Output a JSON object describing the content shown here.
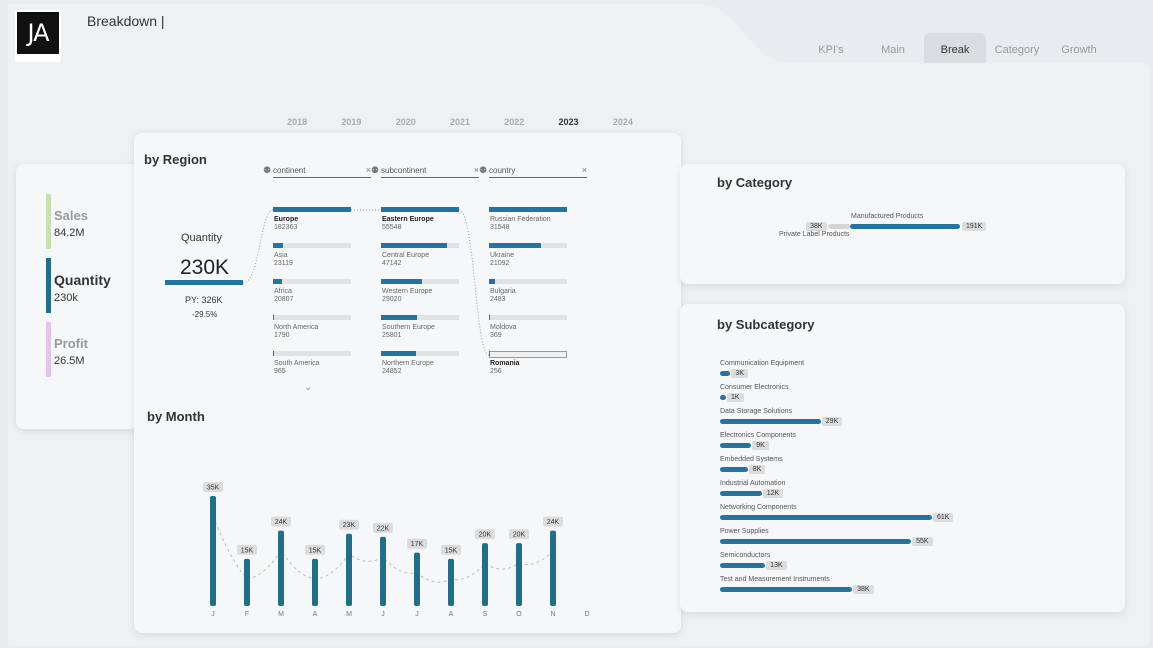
{
  "header": {
    "logo_text": "JA",
    "page_title": "Breakdown |"
  },
  "tabs": [
    {
      "label": "KPI's",
      "active": false
    },
    {
      "label": "Main",
      "active": false
    },
    {
      "label": "Break",
      "active": true
    },
    {
      "label": "Category",
      "active": false
    },
    {
      "label": "Growth",
      "active": false
    }
  ],
  "years": [
    {
      "label": "2018",
      "active": false
    },
    {
      "label": "2019",
      "active": false
    },
    {
      "label": "2020",
      "active": false
    },
    {
      "label": "2021",
      "active": false
    },
    {
      "label": "2022",
      "active": false
    },
    {
      "label": "2023",
      "active": true
    },
    {
      "label": "2024",
      "active": false
    }
  ],
  "kpis": [
    {
      "name": "Sales",
      "value": "84.2M",
      "color": "#c8dfb0",
      "active": false
    },
    {
      "name": "Quantity",
      "value": "230k",
      "color": "#1f6e8c",
      "active": true
    },
    {
      "name": "Profit",
      "value": "26.5M",
      "color": "#e6c3ec",
      "active": false
    }
  ],
  "region": {
    "title": "by Region",
    "metric_label": "Quantity",
    "metric_value": "230K",
    "py_label": "PY: 326K",
    "change": "-29.5%",
    "filters": [
      {
        "placeholder": "continent"
      },
      {
        "placeholder": "subcontinent"
      },
      {
        "placeholder": "country"
      }
    ],
    "continents": [
      {
        "label": "Europe",
        "value": "182363",
        "fill": 1.0,
        "selected": true
      },
      {
        "label": "Asia",
        "value": "23119",
        "fill": 0.13,
        "selected": false
      },
      {
        "label": "Africa",
        "value": "20807",
        "fill": 0.11,
        "selected": false
      },
      {
        "label": "North America",
        "value": "1790",
        "fill": 0.01,
        "selected": false
      },
      {
        "label": "South America",
        "value": "965",
        "fill": 0.005,
        "selected": false
      }
    ],
    "subcontinents": [
      {
        "label": "Eastern Europe",
        "value": "55548",
        "fill": 1.0,
        "selected": true
      },
      {
        "label": "Central Europe",
        "value": "47142",
        "fill": 0.85,
        "selected": false
      },
      {
        "label": "Western Europe",
        "value": "29020",
        "fill": 0.52,
        "selected": false
      },
      {
        "label": "Southern Europe",
        "value": "25801",
        "fill": 0.46,
        "selected": false
      },
      {
        "label": "Northern Europe",
        "value": "24852",
        "fill": 0.45,
        "selected": false
      }
    ],
    "countries": [
      {
        "label": "Russian Federation",
        "value": "31548",
        "fill": 1.0,
        "selected": false
      },
      {
        "label": "Ukraine",
        "value": "21092",
        "fill": 0.67,
        "selected": false
      },
      {
        "label": "Bulgaria",
        "value": "2483",
        "fill": 0.08,
        "selected": false
      },
      {
        "label": "Moldova",
        "value": "369",
        "fill": 0.012,
        "selected": false
      },
      {
        "label": "Romania",
        "value": "256",
        "fill": 0.008,
        "selected": true
      }
    ]
  },
  "month": {
    "title": "by Month",
    "chart_data": {
      "type": "bar",
      "categories": [
        "J",
        "F",
        "M",
        "A",
        "M",
        "J",
        "J",
        "A",
        "S",
        "O",
        "N",
        "D"
      ],
      "values": [
        35,
        15,
        24,
        15,
        23,
        22,
        17,
        15,
        20,
        20,
        24,
        null
      ],
      "labels": [
        "35K",
        "15K",
        "24K",
        "15K",
        "23K",
        "22K",
        "17K",
        "15K",
        "20K",
        "20K",
        "24K",
        ""
      ],
      "bar_color": "#1f6e8c",
      "ylim": [
        0,
        35
      ],
      "grid": false
    }
  },
  "category": {
    "title": "by Category",
    "chart_data": {
      "type": "bar",
      "categories": [
        "Private Label Products",
        "Manufactured Products"
      ],
      "values": [
        38,
        191
      ],
      "labels": [
        "38K",
        "191K"
      ]
    }
  },
  "subcategory": {
    "title": "by Subcategory",
    "chart_data": {
      "type": "bar",
      "categories": [
        "Communication Equipment",
        "Consumer Electronics",
        "Data Storage Solutions",
        "Electronics Components",
        "Embedded Systems",
        "Industrial Automation",
        "Networking Components",
        "Power Supplies",
        "Semiconductors",
        "Test and Measurement Instruments"
      ],
      "values": [
        3,
        1,
        29,
        9,
        8,
        12,
        61,
        55,
        13,
        38
      ],
      "labels": [
        "3K",
        "1K",
        "29K",
        "9K",
        "8K",
        "12K",
        "61K",
        "55K",
        "13K",
        "38K"
      ],
      "bar_color": "#1f6e8c"
    }
  }
}
